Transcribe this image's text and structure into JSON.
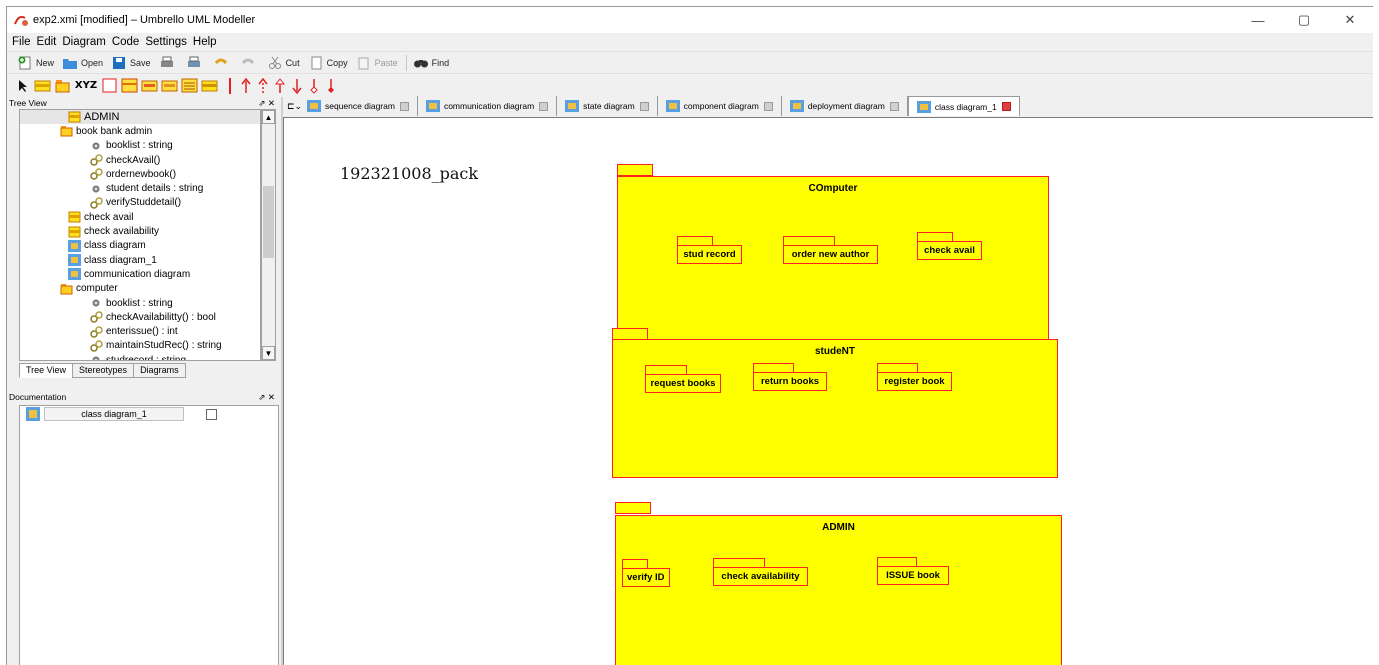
{
  "window": {
    "title": "exp2.xmi [modified] – Umbrello UML Modeller",
    "controls": [
      "—",
      "▢",
      "✕"
    ]
  },
  "menu": [
    "File",
    "Edit",
    "Diagram",
    "Code",
    "Settings",
    "Help"
  ],
  "toolbar": {
    "new": "New",
    "open": "Open",
    "save": "Save",
    "cut": "Cut",
    "copy": "Copy",
    "paste": "Paste",
    "find": "Find"
  },
  "toolbar2_labels": {
    "text": "XYZ"
  },
  "tree_panel": {
    "header": "Tree View",
    "items": [
      {
        "label": "ADMIN",
        "icon": "package-icon",
        "indent": 48
      },
      {
        "label": "book bank admin",
        "icon": "class-icon",
        "indent": 40
      },
      {
        "label": "booklist : string",
        "icon": "attribute-icon",
        "indent": 70
      },
      {
        "label": "checkAvail()",
        "icon": "operation-icon",
        "indent": 70
      },
      {
        "label": "ordernewbook()",
        "icon": "operation-icon",
        "indent": 70
      },
      {
        "label": "student details : string",
        "icon": "attribute-icon",
        "indent": 70
      },
      {
        "label": "verifyStuddetail()",
        "icon": "operation-icon",
        "indent": 70
      },
      {
        "label": "check avail",
        "icon": "package-icon",
        "indent": 48
      },
      {
        "label": "check availability",
        "icon": "package-icon",
        "indent": 48
      },
      {
        "label": "class diagram",
        "icon": "diagram-icon",
        "indent": 48
      },
      {
        "label": "class diagram_1",
        "icon": "diagram-icon",
        "indent": 48
      },
      {
        "label": "communication diagram",
        "icon": "diagram-icon",
        "indent": 48
      },
      {
        "label": "computer",
        "icon": "class-icon",
        "indent": 40
      },
      {
        "label": "booklist : string",
        "icon": "attribute-icon",
        "indent": 70
      },
      {
        "label": "checkAvailabilitty() : bool",
        "icon": "operation-icon",
        "indent": 70
      },
      {
        "label": "enterissue() : int",
        "icon": "operation-icon",
        "indent": 70
      },
      {
        "label": "maintainStudRec() : string",
        "icon": "operation-icon",
        "indent": 70
      },
      {
        "label": "studrecord : string",
        "icon": "attribute-icon",
        "indent": 70
      }
    ],
    "tabs": [
      "Tree View",
      "Stereotypes",
      "Diagrams"
    ]
  },
  "doc_panel": {
    "header": "Documentation",
    "diagram_name": "class diagram_1"
  },
  "diagram_tabs": [
    {
      "label": "sequence diagram",
      "active": false
    },
    {
      "label": "communication diagram",
      "active": false
    },
    {
      "label": "state diagram",
      "active": false
    },
    {
      "label": "component diagram",
      "active": false
    },
    {
      "label": "deployment diagram",
      "active": false
    },
    {
      "label": "class diagram_1",
      "active": true
    }
  ],
  "canvas": {
    "title": "192321008_pack",
    "packages": [
      {
        "name": "COmputer",
        "subpackages": [
          "stud record",
          "order new author",
          "check avail"
        ]
      },
      {
        "name": "studeNT",
        "subpackages": [
          "request books",
          "return books",
          "register book"
        ]
      },
      {
        "name": "ADMIN",
        "subpackages": [
          "verify ID",
          "check availability",
          "ISSUE book"
        ]
      }
    ]
  },
  "colors": {
    "package_fill": "#ffff00",
    "package_border": "#ff2020"
  }
}
